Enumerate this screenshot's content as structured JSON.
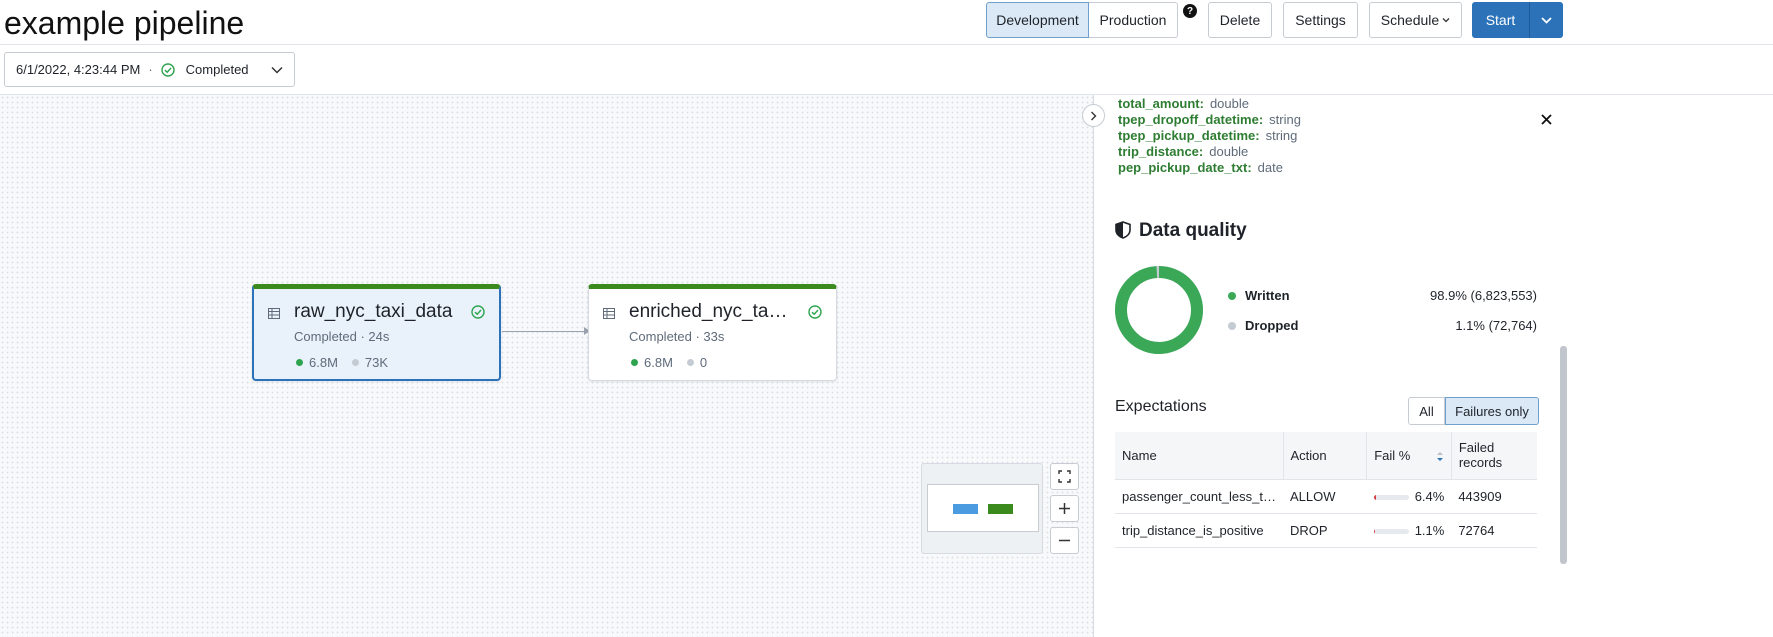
{
  "header": {
    "title": "example pipeline",
    "mode_development": "Development",
    "mode_production": "Production",
    "help": "?",
    "delete_label": "Delete",
    "settings_label": "Settings",
    "schedule_label": "Schedule",
    "start_label": "Start"
  },
  "run_selector": {
    "timestamp": "6/1/2022, 4:23:44 PM",
    "separator": "·",
    "status": "Completed"
  },
  "graph": {
    "nodes": [
      {
        "name": "raw_nyc_taxi_data",
        "status": "Completed · 24s",
        "written": "6.8M",
        "dropped": "73K"
      },
      {
        "name": "enriched_nyc_tax…",
        "status": "Completed · 33s",
        "written": "6.8M",
        "dropped": "0"
      }
    ]
  },
  "panel": {
    "schema": [
      {
        "name": "total_amount:",
        "type": "double"
      },
      {
        "name": "tpep_dropoff_datetime:",
        "type": "string"
      },
      {
        "name": "tpep_pickup_datetime:",
        "type": "string"
      },
      {
        "name": "trip_distance:",
        "type": "double"
      },
      {
        "name": "pep_pickup_date_txt:",
        "type": "date"
      }
    ],
    "data_quality": {
      "title": "Data quality",
      "written_label": "Written",
      "written_value": "98.9% (6,823,553)",
      "written_fraction": 0.989,
      "dropped_label": "Dropped",
      "dropped_value": "1.1% (72,764)",
      "dropped_fraction": 0.011,
      "written_color": "#3aa857",
      "dropped_color": "#c4cbd3"
    },
    "expectations": {
      "title": "Expectations",
      "filter_all": "All",
      "filter_failures": "Failures only",
      "columns": {
        "name": "Name",
        "action": "Action",
        "fail": "Fail %",
        "failed_records": "Failed records"
      },
      "rows": [
        {
          "name": "passenger_count_less_th…",
          "action": "ALLOW",
          "fail": "6.4%",
          "fail_fraction": 0.064,
          "failed_records": "443909"
        },
        {
          "name": "trip_distance_is_positive",
          "action": "DROP",
          "fail": "1.1%",
          "fail_fraction": 0.011,
          "failed_records": "72764"
        }
      ]
    }
  }
}
